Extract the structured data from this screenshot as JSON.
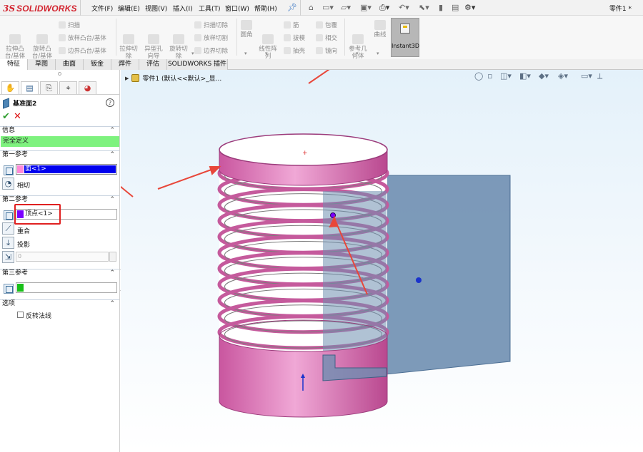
{
  "app": {
    "logo_ds": "3S",
    "logo_name": "SOLIDWORKS",
    "document_title": "零件1 *"
  },
  "menu": [
    "文件(F)",
    "编辑(E)",
    "视图(V)",
    "插入(I)",
    "工具(T)",
    "窗口(W)",
    "帮助(H)"
  ],
  "ribbon": {
    "extrude_boss": "拉伸凸\n台/基体",
    "revolve_boss": "旋转凸\n台/基体",
    "sweep": "扫描",
    "loft": "放样凸台/基体",
    "boundary_boss": "边界凸台/基体",
    "extrude_cut": "拉伸切\n除",
    "hole_wizard": "异型孔\n向导",
    "revolve_cut": "旋转切\n除",
    "swept_cut": "扫描切除",
    "lofted_cut": "放样切割",
    "boundary_cut": "边界切除",
    "fillet": "圆角",
    "linear_pattern": "线性阵\n列",
    "rib": "筋",
    "draft": "拔模",
    "shell": "抽壳",
    "wrap": "包覆",
    "intersect": "相交",
    "mirror": "镜向",
    "ref_geometry": "参考几\n何体",
    "curves": "曲线",
    "instant3d": "Instant3D"
  },
  "tabs": [
    "特征",
    "草图",
    "曲面",
    "钣金",
    "焊件",
    "评估",
    "SOLIDWORKS 插件"
  ],
  "property_manager": {
    "title": "基准面2",
    "help": "?",
    "ok": "✔",
    "cancel": "✕",
    "info_section": "信息",
    "info_status": "完全定义",
    "first_ref_section": "第一参考",
    "first_ref_value": "面<1>",
    "first_ref_constraint": "相切",
    "second_ref_section": "第二参考",
    "second_ref_value": "顶点<1>",
    "second_ref_constraint_1": "重合",
    "second_ref_constraint_2": "投影",
    "second_ref_number": "0",
    "third_ref_section": "第三参考",
    "options_section": "选项",
    "flip_normal": "反转法线",
    "colors": {
      "first": "#ff8ad8",
      "first_sel": "#0000ee",
      "second": "#7a00ff",
      "third": "#18c018",
      "status": "#7ef27e"
    }
  },
  "tree": {
    "part_label": "零件1 (默认<<默认>_显..."
  },
  "model": {
    "body_color": "#d573b4",
    "plane_color": "#6f8fb1",
    "coil_turns": 11,
    "arrow_color": "#e8473a"
  }
}
